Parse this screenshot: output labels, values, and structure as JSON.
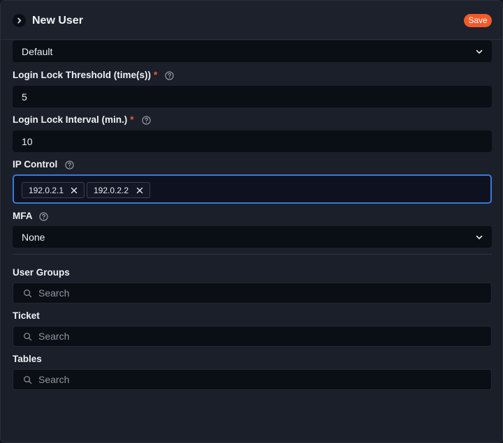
{
  "header": {
    "title": "New User",
    "save_label": "Save"
  },
  "fields": {
    "role_select_value": "Default",
    "login_lock_threshold": {
      "label": "Login Lock Threshold (time(s))",
      "required_mark": "*",
      "value": "5"
    },
    "login_lock_interval": {
      "label": "Login Lock Interval (min.)",
      "required_mark": "*",
      "value": "10"
    },
    "ip_control": {
      "label": "IP Control",
      "tags": [
        "192.0.2.1",
        "192.0.2.2"
      ]
    },
    "mfa": {
      "label": "MFA",
      "value": "None"
    }
  },
  "associations": {
    "user_groups": {
      "label": "User Groups",
      "placeholder": "Search"
    },
    "ticket": {
      "label": "Ticket",
      "placeholder": "Search"
    },
    "tables": {
      "label": "Tables",
      "placeholder": "Search"
    }
  },
  "colors": {
    "accent": "#f25a2a",
    "focus_border": "#3b78d8",
    "panel_bg": "#1b1f2a",
    "input_bg": "#0b0e15"
  },
  "icons": {
    "expand": "chevron-right-icon",
    "dropdown": "chevron-down-icon",
    "help": "help-circle-icon",
    "remove_tag": "close-icon",
    "search": "search-icon"
  }
}
